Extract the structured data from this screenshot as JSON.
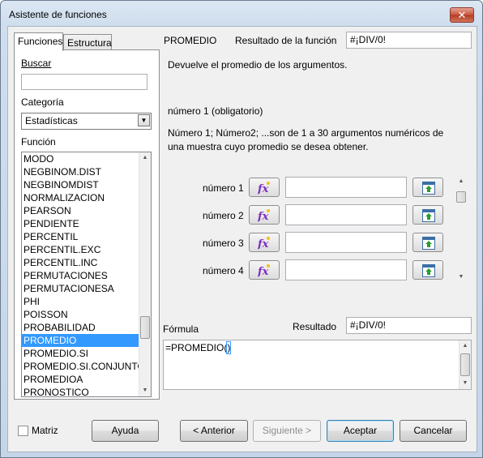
{
  "window": {
    "title": "Asistente de funciones",
    "close_label": "✕"
  },
  "tabs": [
    {
      "label": "Funciones",
      "active": true
    },
    {
      "label": "Estructura",
      "active": false
    }
  ],
  "search": {
    "label": "Buscar",
    "value": ""
  },
  "category": {
    "label": "Categoría",
    "value": "Estadísticas"
  },
  "function_list": {
    "label": "Función",
    "items": [
      "MODO",
      "NEGBINOM.DIST",
      "NEGBINOMDIST",
      "NORMALIZACION",
      "PEARSON",
      "PENDIENTE",
      "PERCENTIL",
      "PERCENTIL.EXC",
      "PERCENTIL.INC",
      "PERMUTACIONES",
      "PERMUTACIONESA",
      "PHI",
      "POISSON",
      "PROBABILIDAD",
      "PROMEDIO",
      "PROMEDIO.SI",
      "PROMEDIO.SI.CONJUNTO",
      "PROMEDIOA",
      "PRONOSTICO"
    ],
    "selected": "PROMEDIO"
  },
  "function": {
    "name": "PROMEDIO",
    "result_label": "Resultado de la función",
    "result_value": "#¡DIV/0!",
    "description": "Devuelve el promedio de los argumentos.",
    "arg_title": "número 1 (obligatorio)",
    "arg_description": "Número 1; Número2; ...son de 1 a 30 argumentos numéricos de una muestra cuyo promedio se desea obtener."
  },
  "arguments": [
    {
      "label": "número 1",
      "value": ""
    },
    {
      "label": "número 2",
      "value": ""
    },
    {
      "label": "número 3",
      "value": ""
    },
    {
      "label": "número 4",
      "value": ""
    }
  ],
  "formula": {
    "label": "Fórmula",
    "result_label": "Resultado",
    "result_value": "#¡DIV/0!",
    "text_before": "=PROMEDIO(",
    "text_after": ")"
  },
  "matrix": {
    "label": "Matriz",
    "checked": false
  },
  "buttons": {
    "help": "Ayuda",
    "back": "< Anterior",
    "next": "Siguiente >",
    "ok": "Aceptar",
    "cancel": "Cancelar"
  },
  "colors": {
    "selection": "#3399ff",
    "fx_icon": "#7b2fbf",
    "arrow_icon": "#2e9b2e"
  },
  "icons": {
    "function_button": "fx-icon",
    "shrink_button": "shrink-icon"
  }
}
